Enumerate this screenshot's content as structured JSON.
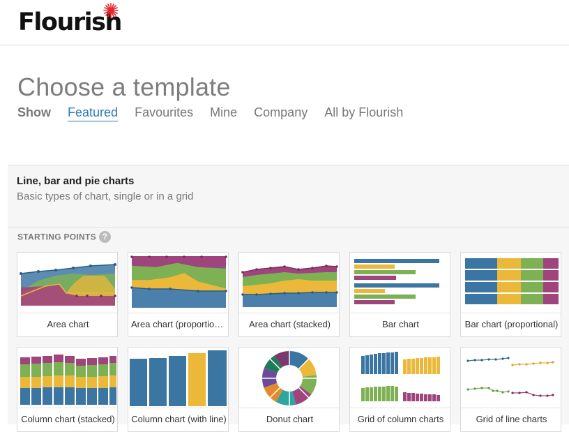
{
  "brand": {
    "name": "Flourish",
    "accent": "#e8242a"
  },
  "page": {
    "title": "Choose a template",
    "show_label": "Show",
    "nav": [
      "Featured",
      "Favourites",
      "Mine",
      "Company",
      "All by Flourish"
    ],
    "active_nav": "Featured"
  },
  "section": {
    "title": "Line, bar and pie charts",
    "description": "Basic types of chart, single or in a grid",
    "starting_points_label": "STARTING POINTS",
    "help_glyph": "?"
  },
  "templates": [
    "Area chart",
    "Area chart (proportional)",
    "Area chart (stacked)",
    "Bar chart",
    "Bar chart (proportional)",
    "Column chart (stacked)",
    "Column chart (with line)",
    "Donut chart",
    "Grid of column charts",
    "Grid of line charts"
  ],
  "colors": {
    "blue": "#3b75a2",
    "green": "#7db154",
    "yellow": "#ebb83a",
    "purple": "#a0447e",
    "link": "#2b79b3"
  }
}
